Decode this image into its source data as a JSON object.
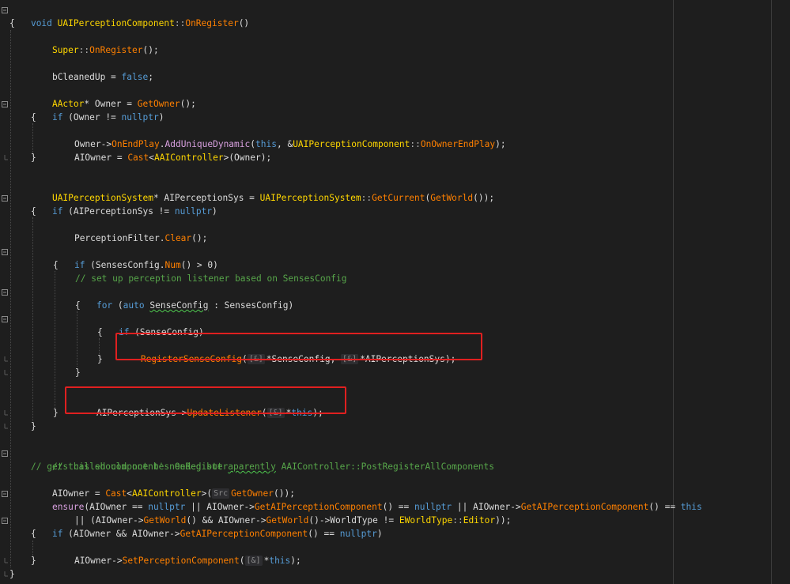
{
  "colors": {
    "background": "#1e1e1e",
    "keyword": "#569cd6",
    "function": "#ff8000",
    "macro_purple": "#d8a0df",
    "comment": "#57a64a",
    "highlight_box": "#e02020"
  },
  "code": {
    "l1": [
      "void",
      "UAIPerceptionComponent",
      "::",
      "OnRegister",
      "()"
    ],
    "l2": "{",
    "l3": [
      "Super",
      "::",
      "OnRegister",
      "();"
    ],
    "l5": [
      "bCleanedUp",
      " = ",
      "false",
      ";"
    ],
    "l7": [
      "AActor",
      "* Owner = ",
      "GetOwner",
      "();"
    ],
    "l8": [
      "if",
      " (Owner != ",
      "nullptr",
      ")"
    ],
    "l9": "{",
    "l10": [
      "Owner->",
      "OnEndPlay",
      ".",
      "AddUniqueDynamic",
      "(",
      "this",
      ", &",
      "UAIPerceptionComponent",
      "::",
      "OnOwnerEndPlay",
      ");"
    ],
    "l11": [
      "AIOwner = ",
      "Cast",
      "<",
      "AAIController",
      ">(Owner);"
    ],
    "l12": "}",
    "l14": [
      "UAIPerceptionSystem",
      "* AIPerceptionSys = ",
      "UAIPerceptionSystem",
      "::",
      "GetCurrent",
      "(",
      "GetWorld",
      "());"
    ],
    "l15": [
      "if",
      " (AIPerceptionSys != ",
      "nullptr",
      ")"
    ],
    "l16": "{",
    "l17": [
      "PerceptionFilter.",
      "Clear",
      "();"
    ],
    "l19": [
      "if",
      " (SensesConfig.",
      "Num",
      "() > 0)"
    ],
    "l20": "{",
    "l21": "// set up perception listener based on SensesConfig",
    "l22": [
      "for",
      " (",
      "auto",
      " ",
      "SenseConfig",
      " : SensesConfig)"
    ],
    "l23": "{",
    "l24": [
      "if",
      " (SenseConfig)"
    ],
    "l25": "{",
    "l26": [
      "RegisterSenseConfig",
      "(",
      "[&]",
      "*SenseConfig, ",
      "[&]",
      "*AIPerceptionSys);"
    ],
    "l27": "}",
    "l28": "}",
    "l30": [
      "AIPerceptionSys->",
      "UpdateListener",
      "(",
      "[&]",
      "*",
      "this",
      ");"
    ],
    "l31": "}",
    "l32": "}",
    "l34": [
      "// this should not be needed but ",
      "aparently",
      " AAIController::PostRegisterAllComponents"
    ],
    "l35": "// gets called component's OnRegister",
    "l36": [
      "AIOwner = ",
      "Cast",
      "<",
      "AAIController",
      ">(",
      "Src",
      "GetOwner",
      "());"
    ],
    "l37": [
      "ensure",
      "(AIOwner == ",
      "nullptr",
      " || AIOwner->",
      "GetAIPerceptionComponent",
      "() == ",
      "nullptr",
      " || AIOwner->",
      "GetAIPerceptionComponent",
      "() == ",
      "this"
    ],
    "l38": [
      "|| (AIOwner->",
      "GetWorld",
      "() && AIOwner->",
      "GetWorld",
      "()->WorldType != ",
      "EWorldType",
      "::",
      "Editor",
      "));"
    ],
    "l39": [
      "if",
      " (AIOwner && AIOwner->",
      "GetAIPerceptionComponent",
      "() == ",
      "nullptr",
      ")"
    ],
    "l40": "{",
    "l41": [
      "AIOwner->",
      "SetPerceptionComponent",
      "(",
      "[&]",
      "*",
      "this",
      ");"
    ],
    "l42": "}",
    "l43": "}"
  }
}
